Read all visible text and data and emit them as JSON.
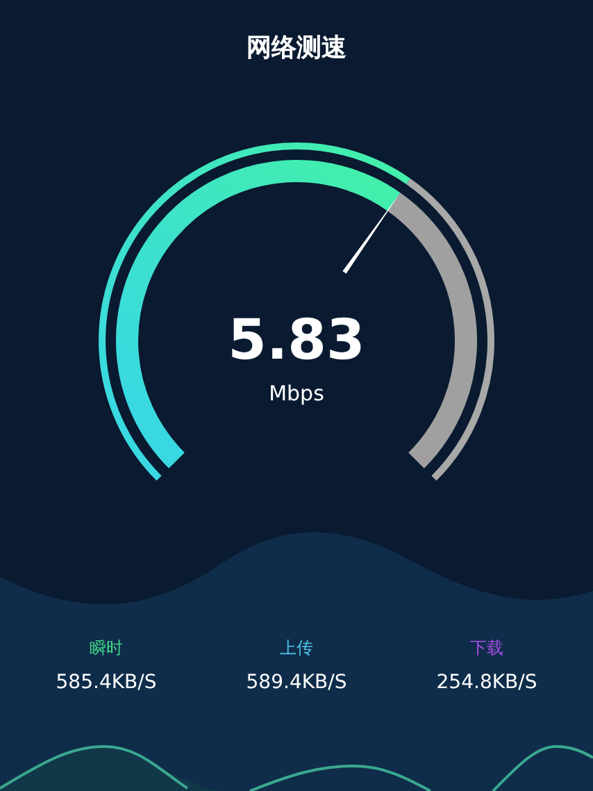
{
  "title": "网络测速",
  "gauge": {
    "value": "5.83",
    "unit": "Mbps"
  },
  "stats": [
    {
      "label": "瞬时",
      "value": "585.4KB/S",
      "color": "#3fd98a"
    },
    {
      "label": "上传",
      "value": "589.4KB/S",
      "color": "#4fc3e8"
    },
    {
      "label": "下载",
      "value": "254.8KB/S",
      "color": "#a64ee8"
    }
  ]
}
